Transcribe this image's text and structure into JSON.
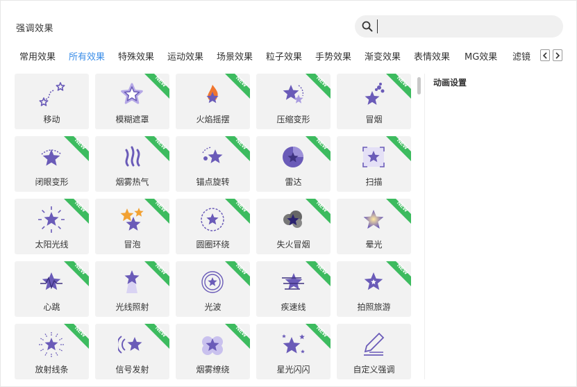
{
  "dialog": {
    "title": "强调效果"
  },
  "search": {
    "placeholder": "",
    "value": ""
  },
  "tabs": [
    {
      "label": "常用效果",
      "active": false
    },
    {
      "label": "所有效果",
      "active": true
    },
    {
      "label": "特殊效果",
      "active": false
    },
    {
      "label": "运动效果",
      "active": false
    },
    {
      "label": "场景效果",
      "active": false
    },
    {
      "label": "粒子效果",
      "active": false
    },
    {
      "label": "手势效果",
      "active": false
    },
    {
      "label": "渐变效果",
      "active": false
    },
    {
      "label": "表情效果",
      "active": false
    },
    {
      "label": "MG效果",
      "active": false
    },
    {
      "label": "滤镜",
      "active": false
    }
  ],
  "badge_text": "NEW",
  "effects": [
    {
      "label": "移动",
      "icon": "move-path-icon",
      "is_new": false
    },
    {
      "label": "模糊遮罩",
      "icon": "blur-mask-star-icon",
      "is_new": true
    },
    {
      "label": "火焰摇摆",
      "icon": "flame-icon",
      "is_new": true
    },
    {
      "label": "压缩变形",
      "icon": "compress-star-icon",
      "is_new": true
    },
    {
      "label": "冒烟",
      "icon": "smoke-star-icon",
      "is_new": true
    },
    {
      "label": "闭眼变形",
      "icon": "eye-close-star-icon",
      "is_new": true
    },
    {
      "label": "烟雾热气",
      "icon": "heat-smoke-icon",
      "is_new": true
    },
    {
      "label": "锚点旋转",
      "icon": "anchor-rotate-icon",
      "is_new": true
    },
    {
      "label": "雷达",
      "icon": "radar-icon",
      "is_new": true
    },
    {
      "label": "扫描",
      "icon": "scan-icon",
      "is_new": true
    },
    {
      "label": "太阳光线",
      "icon": "sun-rays-icon",
      "is_new": true
    },
    {
      "label": "冒泡",
      "icon": "bubble-stars-icon",
      "is_new": true
    },
    {
      "label": "圆圈环绕",
      "icon": "circle-surround-icon",
      "is_new": true
    },
    {
      "label": "失火冒烟",
      "icon": "fire-smoke-icon",
      "is_new": true
    },
    {
      "label": "晕光",
      "icon": "glow-star-icon",
      "is_new": true
    },
    {
      "label": "心跳",
      "icon": "heartbeat-star-icon",
      "is_new": true
    },
    {
      "label": "光线照射",
      "icon": "light-beam-icon",
      "is_new": true
    },
    {
      "label": "光波",
      "icon": "light-wave-icon",
      "is_new": true
    },
    {
      "label": "疾速线",
      "icon": "speed-lines-icon",
      "is_new": true
    },
    {
      "label": "拍照旅游",
      "icon": "photo-sparkle-icon",
      "is_new": true
    },
    {
      "label": "放射线条",
      "icon": "radial-lines-icon",
      "is_new": true
    },
    {
      "label": "信号发射",
      "icon": "signal-star-icon",
      "is_new": true
    },
    {
      "label": "烟雾缭绕",
      "icon": "smoke-cloud-icon",
      "is_new": true
    },
    {
      "label": "星光闪闪",
      "icon": "twinkle-star-icon",
      "is_new": true
    },
    {
      "label": "自定义强调",
      "icon": "custom-pen-icon",
      "is_new": false
    }
  ],
  "panel": {
    "title": "动画设置"
  },
  "colors": {
    "accent": "#3b8ee8",
    "star": "#6a5bb8",
    "badge": "#3dbb5f",
    "card_bg": "#f2f2f2"
  }
}
